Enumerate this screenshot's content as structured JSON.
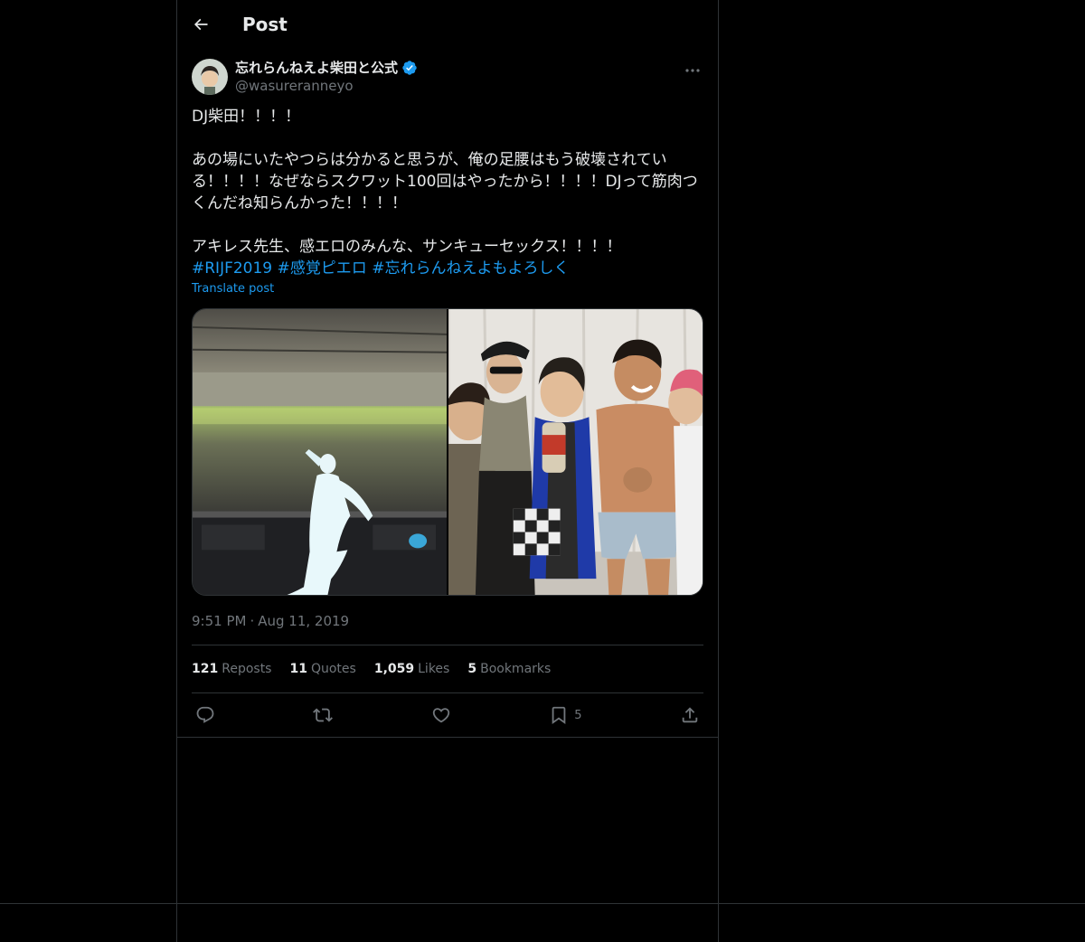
{
  "header": {
    "title": "Post",
    "back_icon": "arrow-left-icon"
  },
  "author": {
    "display_name": "忘れらんねえよ柴田と公式",
    "handle": "@wasureranneyo",
    "verified": true,
    "verified_color": "#1d9bf0"
  },
  "post": {
    "text": "DJ柴田！！！！\n\nあの場にいたやつらは分かると思うが、俺の足腰はもう破壊されてい\nる！！！！なぜならスクワット100回はやったから！！！！DJって筋肉つ\nくんだね知らんかった！！！！\n\nアキレス先生、感エロのみんな、サンキューセックス！！！！\n",
    "hashtags": [
      "#RIJF2019",
      "#感覚ピエロ",
      "#忘れらんねえよもよろしく"
    ],
    "translate_label": "Translate post",
    "time": "9:51 PM",
    "separator": "·",
    "date": "Aug 11, 2019"
  },
  "stats": {
    "reposts": {
      "count": "121",
      "label": "Reposts"
    },
    "quotes": {
      "count": "11",
      "label": "Quotes"
    },
    "likes": {
      "count": "1,059",
      "label": "Likes"
    },
    "bookmarks": {
      "count": "5",
      "label": "Bookmarks"
    }
  },
  "actions": {
    "reply": "reply-icon",
    "repost": "repost-icon",
    "like": "heart-icon",
    "bookmark": "bookmark-icon",
    "bookmark_count": "5",
    "share": "share-icon"
  },
  "colors": {
    "background": "#000000",
    "text": "#e7e9ea",
    "muted": "#71767b",
    "accent": "#1d9bf0",
    "border": "#2f3336"
  }
}
